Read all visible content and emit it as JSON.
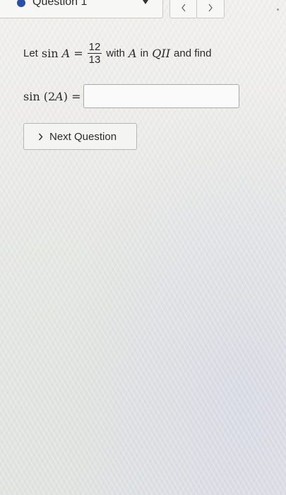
{
  "header": {
    "question_label": "Question 1",
    "status_color": "#2a4fa8",
    "prev_icon": "chevron-left-icon",
    "next_icon": "chevron-right-icon"
  },
  "problem": {
    "prefix": "Let",
    "func": "sin",
    "variable": "A",
    "equals": "=",
    "numerator": "12",
    "denominator": "13",
    "middle": "with",
    "variable2": "A",
    "in_word": "in",
    "quadrant": "QII",
    "suffix": "and find"
  },
  "answer": {
    "func": "sin",
    "open": "(2",
    "variable": "A",
    "close": ")",
    "equals": "=",
    "value": ""
  },
  "next_button": {
    "label": "Next Question"
  }
}
